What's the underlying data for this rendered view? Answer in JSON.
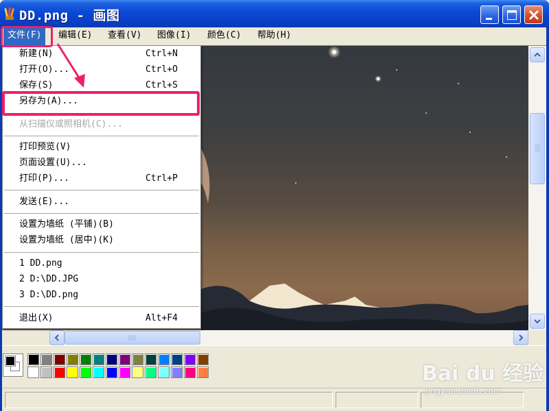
{
  "window": {
    "title": "DD.png - 画图"
  },
  "menubar": {
    "items": [
      {
        "label": "文件(F)"
      },
      {
        "label": "编辑(E)"
      },
      {
        "label": "查看(V)"
      },
      {
        "label": "图像(I)"
      },
      {
        "label": "颜色(C)"
      },
      {
        "label": "帮助(H)"
      }
    ]
  },
  "file_menu": {
    "items": [
      {
        "label": "新建(N)",
        "shortcut": "Ctrl+N"
      },
      {
        "label": "打开(O)...",
        "shortcut": "Ctrl+O"
      },
      {
        "label": "保存(S)",
        "shortcut": "Ctrl+S"
      },
      {
        "label": "另存为(A)...",
        "shortcut": ""
      },
      {
        "label": "从扫描仪或照相机(C)...",
        "shortcut": ""
      },
      {
        "label": "打印预览(V)",
        "shortcut": ""
      },
      {
        "label": "页面设置(U)...",
        "shortcut": ""
      },
      {
        "label": "打印(P)...",
        "shortcut": "Ctrl+P"
      },
      {
        "label": "发送(E)...",
        "shortcut": ""
      },
      {
        "label": "设置为墙纸 (平铺)(B)",
        "shortcut": ""
      },
      {
        "label": "设置为墙纸 (居中)(K)",
        "shortcut": ""
      },
      {
        "label": "1 DD.png",
        "shortcut": ""
      },
      {
        "label": "2 D:\\DD.JPG",
        "shortcut": ""
      },
      {
        "label": "3 D:\\DD.png",
        "shortcut": ""
      },
      {
        "label": "退出(X)",
        "shortcut": "Alt+F4"
      }
    ]
  },
  "palette": {
    "row1": [
      "#000000",
      "#808080",
      "#800000",
      "#808000",
      "#008000",
      "#008080",
      "#000080",
      "#800080",
      "#808040",
      "#004040",
      "#0080ff",
      "#004080",
      "#8000ff",
      "#804000"
    ],
    "row2": [
      "#ffffff",
      "#c0c0c0",
      "#ff0000",
      "#ffff00",
      "#00ff00",
      "#00ffff",
      "#0000ff",
      "#ff00ff",
      "#ffff80",
      "#00ff80",
      "#80ffff",
      "#8080ff",
      "#ff0080",
      "#ff8040"
    ]
  },
  "watermark": {
    "brand": "Bai du 经验",
    "url": "jingyan.baidu.com"
  },
  "colors": {
    "highlight": "#ec1f6b",
    "titlebar": "#0a49d6",
    "menu_selected": "#316ac5"
  }
}
